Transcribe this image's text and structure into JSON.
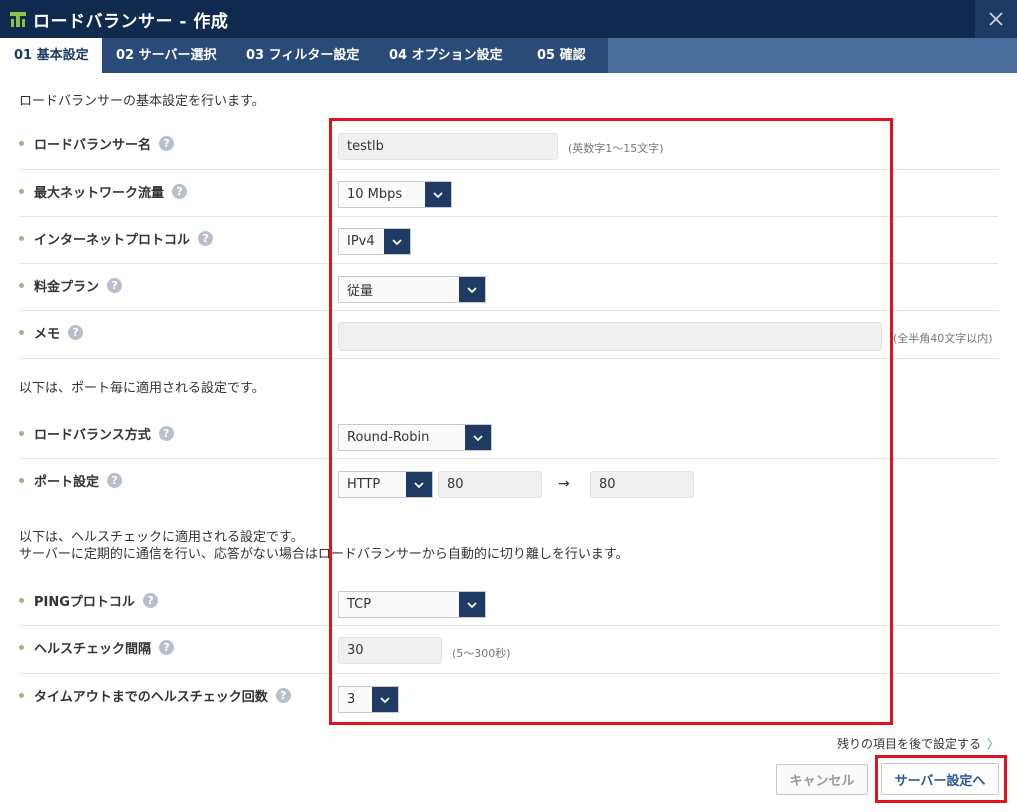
{
  "window": {
    "title": "ロードバランサー - 作成",
    "close_icon": "close-icon"
  },
  "tabs": [
    {
      "label": "01 基本設定",
      "active": true
    },
    {
      "label": "02 サーバー選択",
      "active": false
    },
    {
      "label": "03 フィルター設定",
      "active": false
    },
    {
      "label": "04 オプション設定",
      "active": false
    },
    {
      "label": "05 確認",
      "active": false
    }
  ],
  "intro": "ロードバランサーの基本設定を行います。",
  "basic": {
    "name": {
      "label": "ロードバランサー名",
      "value": "testlb",
      "hint": "(英数字1～15文字)"
    },
    "bandwidth": {
      "label": "最大ネットワーク流量",
      "value": "10 Mbps"
    },
    "protocol": {
      "label": "インターネットプロトコル",
      "value": "IPv4"
    },
    "plan": {
      "label": "料金プラン",
      "value": "従量"
    },
    "memo": {
      "label": "メモ",
      "value": "",
      "hint": "(全半角40文字以内)"
    }
  },
  "port_section": {
    "text": "以下は、ポート毎に適用される設定です。",
    "method": {
      "label": "ロードバランス方式",
      "value": "Round-Robin"
    },
    "port": {
      "label": "ポート設定",
      "protocol": "HTTP",
      "from": "80",
      "arrow": "→",
      "to": "80"
    }
  },
  "health_section": {
    "text_line1": "以下は、ヘルスチェックに適用される設定です。",
    "text_line2": "サーバーに定期的に通信を行い、応答がない場合はロードバランサーから自動的に切り離しを行います。",
    "ping": {
      "label": "PINGプロトコル",
      "value": "TCP"
    },
    "interval": {
      "label": "ヘルスチェック間隔",
      "value": "30",
      "hint": "(5～300秒)"
    },
    "count": {
      "label": "タイムアウトまでのヘルスチェック回数",
      "value": "3"
    }
  },
  "footer": {
    "later_link": "残りの項目を後で設定する",
    "later_chevron": "〉",
    "cancel": "キャンセル",
    "next": "サーバー設定へ"
  },
  "help_glyph": "?",
  "colors": {
    "titlebar": "#0f2a4e",
    "tabbar": "#3b5e8e",
    "select_button": "#1f3b63",
    "highlight": "#e0121d"
  }
}
